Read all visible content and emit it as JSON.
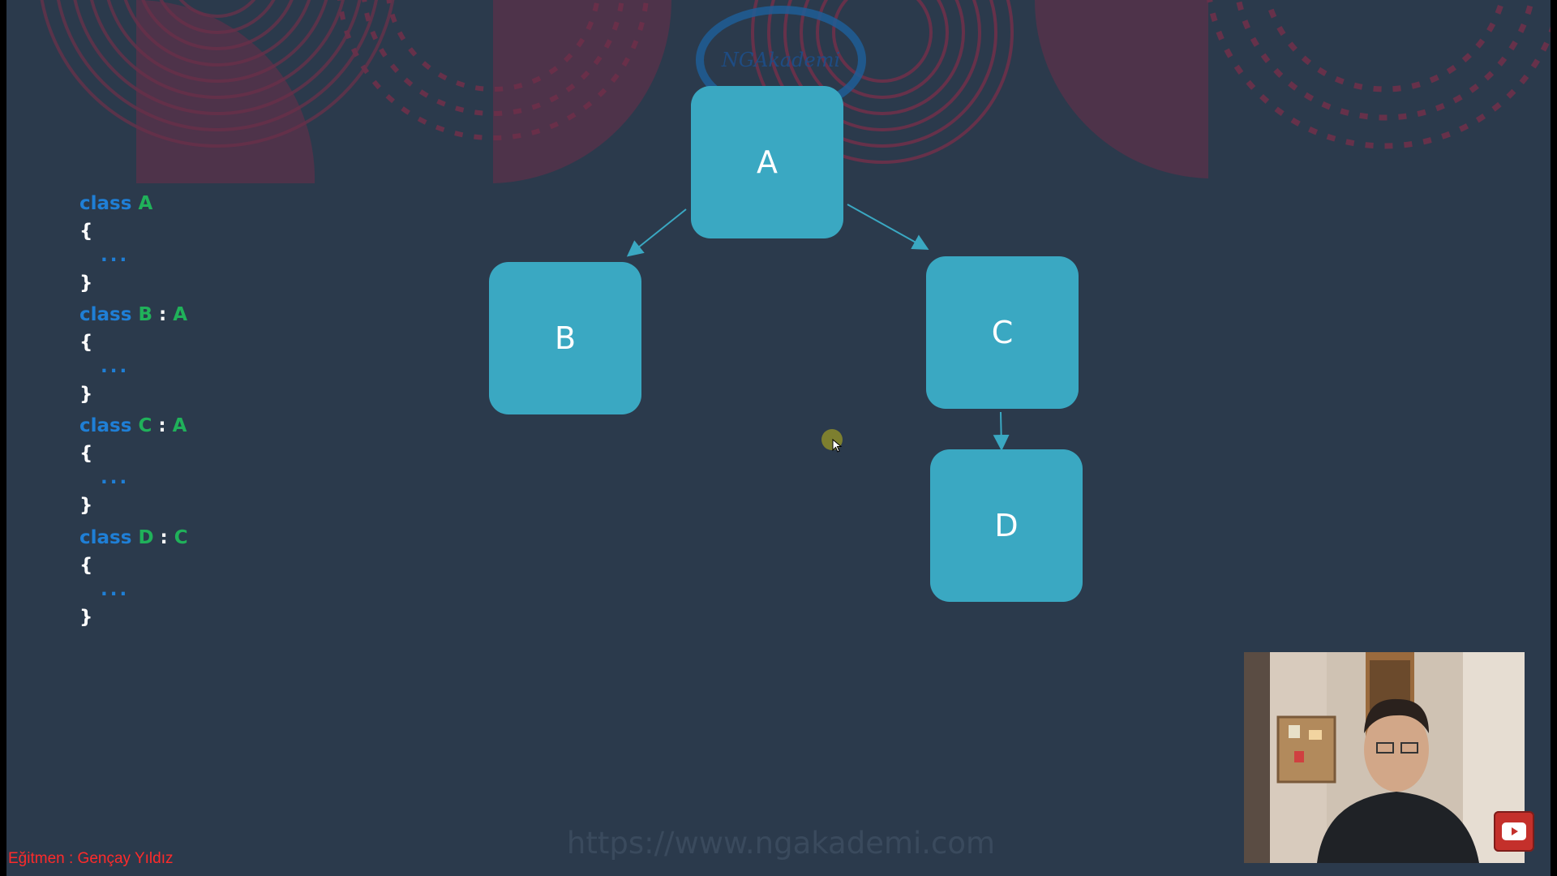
{
  "code": [
    {
      "keyword": "class",
      "name": "A",
      "base": null,
      "open": "{",
      "body": "...",
      "close": "}"
    },
    {
      "keyword": "class",
      "name": "B",
      "base": "A",
      "open": "{",
      "body": "...",
      "close": "}"
    },
    {
      "keyword": "class",
      "name": "C",
      "base": "A",
      "open": "{",
      "body": "...",
      "close": "}"
    },
    {
      "keyword": "class",
      "name": "D",
      "base": "C",
      "open": "{",
      "body": "...",
      "close": "}"
    }
  ],
  "diagram": {
    "nodes": [
      "A",
      "B",
      "C",
      "D"
    ],
    "edges": [
      [
        "A",
        "B"
      ],
      [
        "A",
        "C"
      ],
      [
        "C",
        "D"
      ]
    ]
  },
  "logo_text": "NGAkademi",
  "url": "https://www.ngakademi.com",
  "instructor_label": "Eğitmen : Gençay Yıldız",
  "colors": {
    "background": "#2b3a4c",
    "node": "#3aa8c2",
    "keyword": "#1f7fd6",
    "class_name": "#20b15a",
    "instructor_text": "#ff2a2a",
    "decor": "#7a2f4a"
  },
  "icons": {
    "cursor": "mouse-pointer-icon",
    "video": "youtube-play-icon"
  }
}
